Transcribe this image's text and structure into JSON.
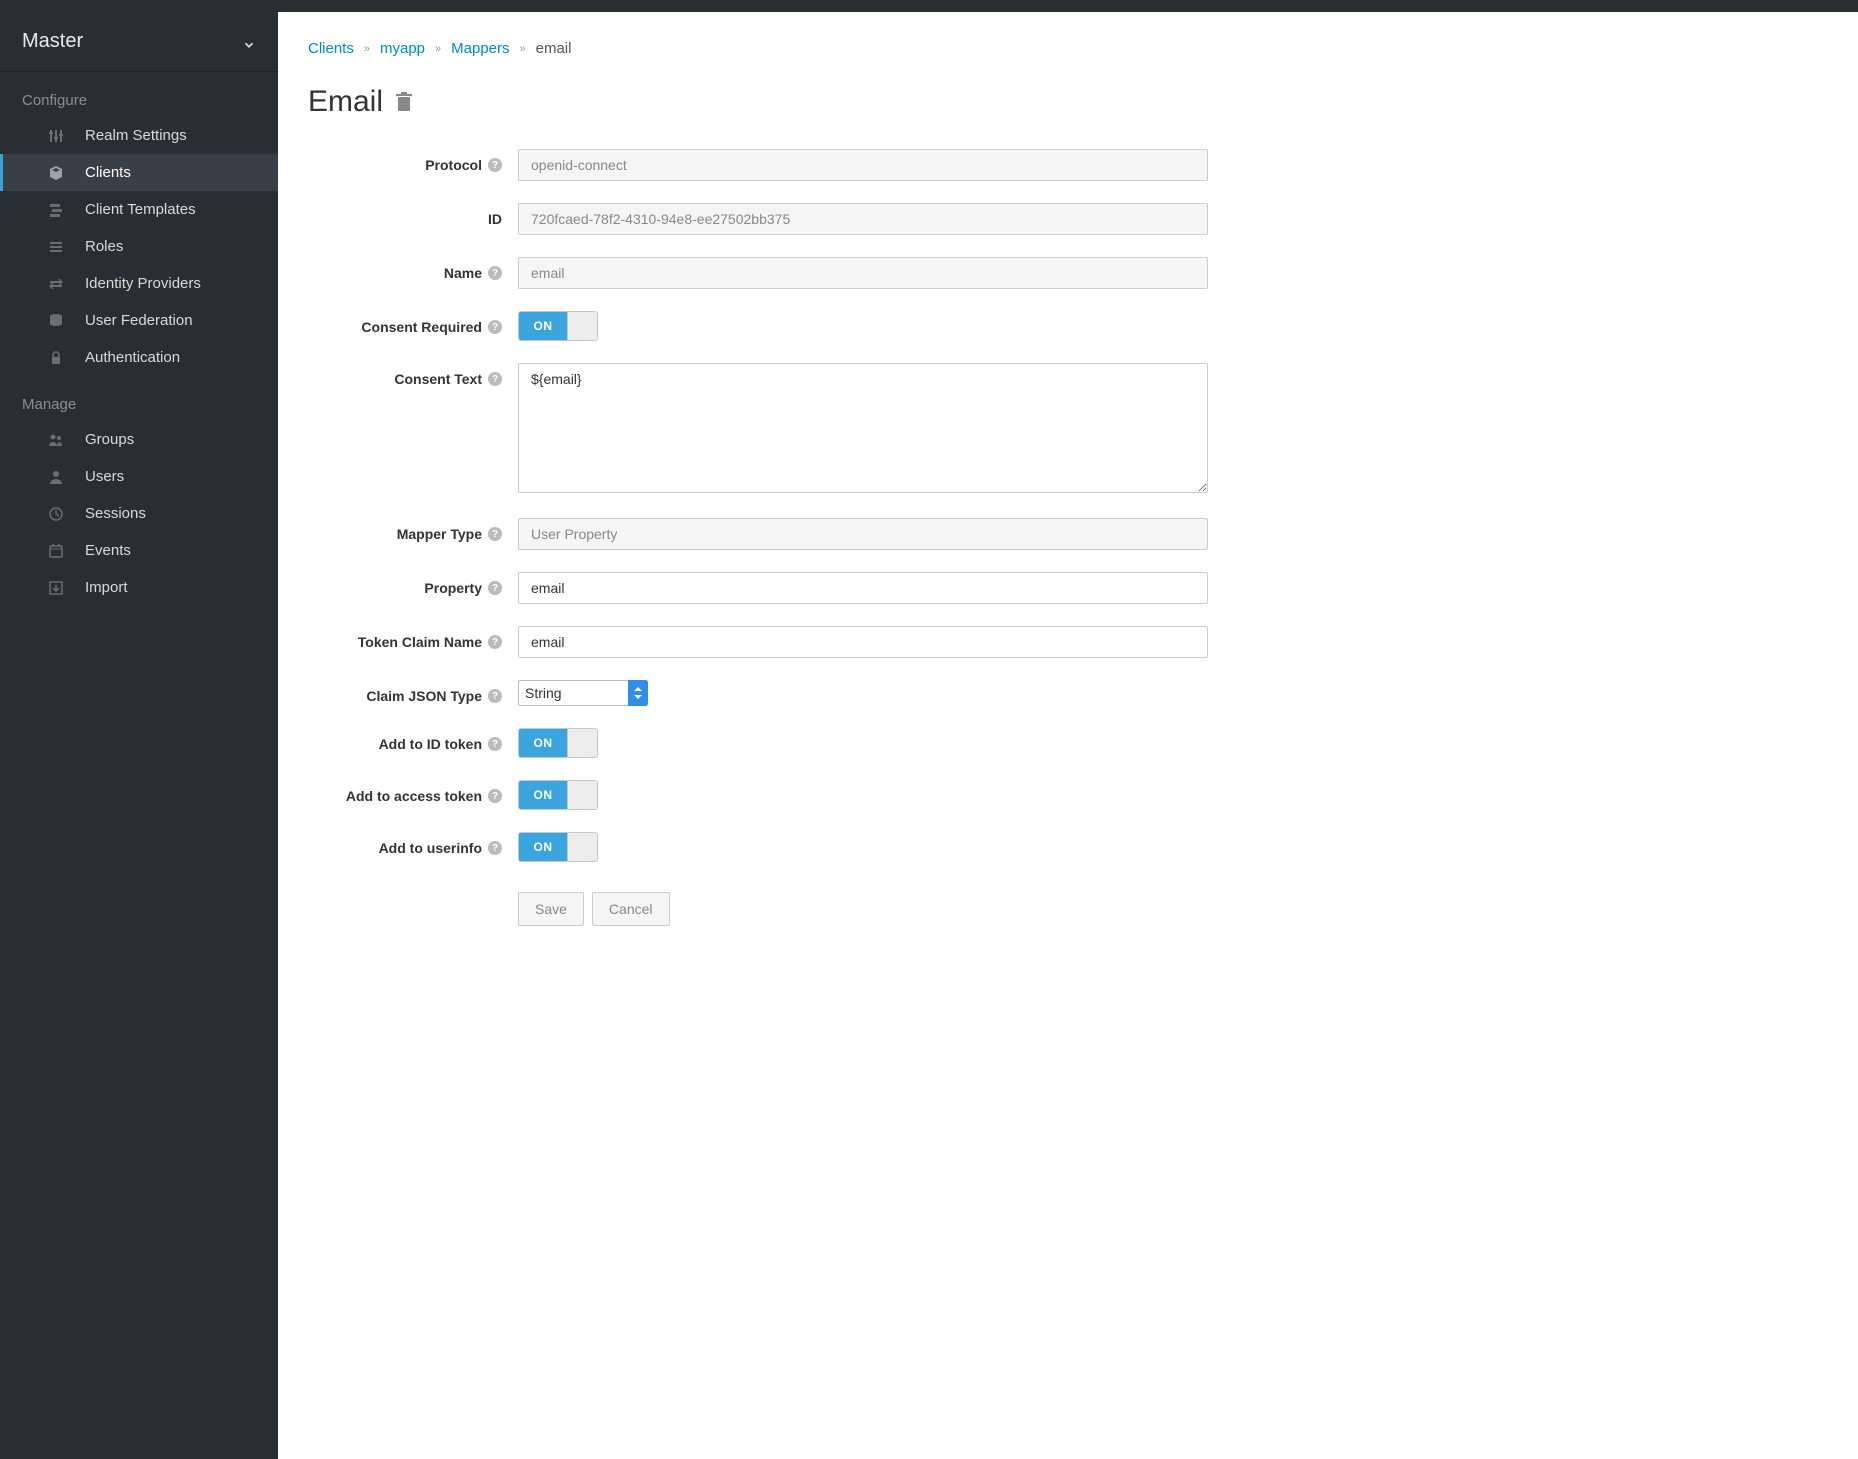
{
  "realm": {
    "name": "Master"
  },
  "sidebar": {
    "sections": [
      {
        "title": "Configure",
        "items": [
          {
            "label": "Realm Settings",
            "icon": "sliders-icon",
            "active": false
          },
          {
            "label": "Clients",
            "icon": "cube-icon",
            "active": true
          },
          {
            "label": "Client Templates",
            "icon": "templates-icon",
            "active": false
          },
          {
            "label": "Roles",
            "icon": "list-icon",
            "active": false
          },
          {
            "label": "Identity Providers",
            "icon": "exchange-icon",
            "active": false
          },
          {
            "label": "User Federation",
            "icon": "database-icon",
            "active": false
          },
          {
            "label": "Authentication",
            "icon": "lock-icon",
            "active": false
          }
        ]
      },
      {
        "title": "Manage",
        "items": [
          {
            "label": "Groups",
            "icon": "users-icon",
            "active": false
          },
          {
            "label": "Users",
            "icon": "user-icon",
            "active": false
          },
          {
            "label": "Sessions",
            "icon": "clock-icon",
            "active": false
          },
          {
            "label": "Events",
            "icon": "calendar-icon",
            "active": false
          },
          {
            "label": "Import",
            "icon": "import-icon",
            "active": false
          }
        ]
      }
    ]
  },
  "breadcrumb": {
    "items": [
      {
        "label": "Clients",
        "link": true
      },
      {
        "label": "myapp",
        "link": true
      },
      {
        "label": "Mappers",
        "link": true
      },
      {
        "label": "email",
        "link": false
      }
    ]
  },
  "page": {
    "title": "Email"
  },
  "form": {
    "protocol": {
      "label": "Protocol",
      "value": "openid-connect"
    },
    "id": {
      "label": "ID",
      "value": "720fcaed-78f2-4310-94e8-ee27502bb375"
    },
    "name": {
      "label": "Name",
      "value": "email"
    },
    "consent_required": {
      "label": "Consent Required",
      "value": "ON"
    },
    "consent_text": {
      "label": "Consent Text",
      "value": "${email}"
    },
    "mapper_type": {
      "label": "Mapper Type",
      "value": "User Property"
    },
    "property": {
      "label": "Property",
      "value": "email"
    },
    "token_claim_name": {
      "label": "Token Claim Name",
      "value": "email"
    },
    "claim_json_type": {
      "label": "Claim JSON Type",
      "value": "String"
    },
    "add_to_id_token": {
      "label": "Add to ID token",
      "value": "ON"
    },
    "add_to_access_token": {
      "label": "Add to access token",
      "value": "ON"
    },
    "add_to_userinfo": {
      "label": "Add to userinfo",
      "value": "ON"
    }
  },
  "actions": {
    "save": "Save",
    "cancel": "Cancel"
  },
  "toggle_on_label": "ON"
}
